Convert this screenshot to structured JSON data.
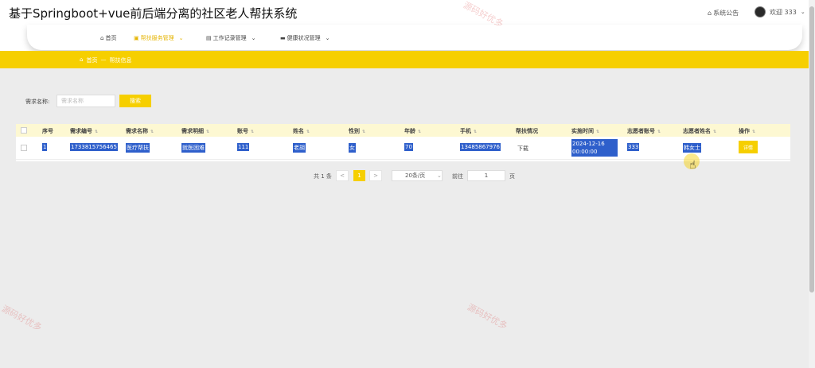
{
  "app": {
    "title": "基于Springboot+vue前后端分离的社区老人帮扶系统"
  },
  "header": {
    "notice_label": "系统公告",
    "user_greeting": "欢迎 333"
  },
  "nav": {
    "items": [
      {
        "label": "首页",
        "icon": "home-icon"
      },
      {
        "label": "帮扶服务管理",
        "icon": "box-icon",
        "active": true
      },
      {
        "label": "工作记录管理",
        "icon": "briefcase-icon"
      },
      {
        "label": "健康状况管理",
        "icon": "monitor-icon"
      }
    ]
  },
  "breadcrumb": {
    "home": "首页",
    "separator": "—",
    "current": "帮扶信息"
  },
  "search": {
    "label": "需求名称:",
    "placeholder": "需求名称",
    "button": "搜索"
  },
  "table": {
    "headers": [
      "序号",
      "需求编号",
      "需求名称",
      "需求明细",
      "账号",
      "姓名",
      "性别",
      "年龄",
      "手机",
      "帮扶情况",
      "实施时间",
      "志愿者账号",
      "志愿者姓名",
      "操作"
    ],
    "rows": [
      {
        "index": "1",
        "req_no": "1733815756465",
        "req_name": "医疗帮扶",
        "req_detail": "就医困难",
        "account": "111",
        "name": "老胡",
        "gender": "女",
        "age": "70",
        "phone": "13485867976",
        "help_status": "下载",
        "time": "2024-12-16 00:00:00",
        "vol_account": "333",
        "vol_name": "韩女士",
        "action": "详情"
      }
    ]
  },
  "pagination": {
    "total": "共 1 条",
    "prev": "<",
    "current": "1",
    "next": ">",
    "page_size": "20条/页",
    "goto_label": "前往",
    "goto_value": "1",
    "page_suffix": "页"
  },
  "watermark": "源码好优多",
  "colors": {
    "accent": "#f6cf00",
    "selection": "#2e5fcb"
  }
}
